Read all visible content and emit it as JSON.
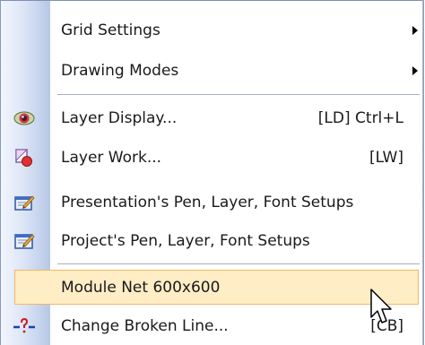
{
  "menu": {
    "items": [
      {
        "label": "Grid Settings",
        "shortcut": "",
        "submenu": true,
        "icon": ""
      },
      {
        "label": "Drawing Modes",
        "shortcut": "",
        "submenu": true,
        "icon": ""
      },
      {
        "label": "Layer Display...",
        "shortcut": "[LD] Ctrl+L",
        "submenu": false,
        "icon": "eye-icon"
      },
      {
        "label": "Layer Work...",
        "shortcut": "[LW]",
        "submenu": false,
        "icon": "layer-work-icon"
      },
      {
        "label": "Presentation's Pen, Layer, Font Setups",
        "shortcut": "",
        "submenu": false,
        "icon": "presentation-setup-icon"
      },
      {
        "label": "Project's Pen, Layer, Font Setups",
        "shortcut": "",
        "submenu": false,
        "icon": "project-setup-icon"
      },
      {
        "label": "Module Net 600x600",
        "shortcut": "",
        "submenu": false,
        "icon": "",
        "highlighted": true
      },
      {
        "label": "Change Broken Line...",
        "shortcut": "[CB]",
        "submenu": false,
        "icon": "broken-line-icon"
      }
    ]
  },
  "colors": {
    "highlight_fill": "#ffedc6",
    "highlight_border": "#f3b664",
    "gutter": "#b7c7e6"
  }
}
